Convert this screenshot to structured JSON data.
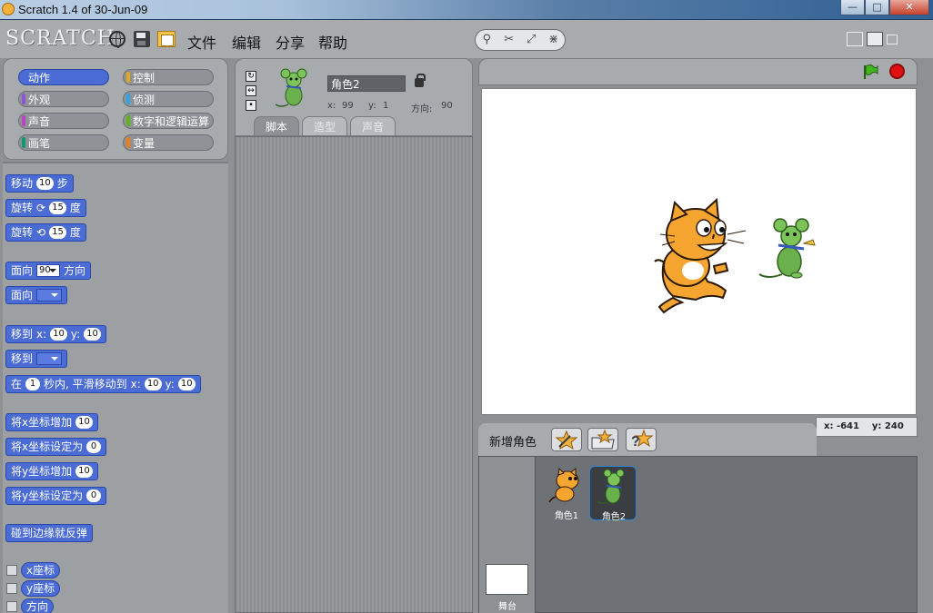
{
  "window": {
    "title": "Scratch 1.4 of 30-Jun-09",
    "controls": [
      "—",
      "□",
      "✕"
    ]
  },
  "menubar": {
    "logo": "SCRATCH",
    "items": [
      "文件",
      "编辑",
      "分享",
      "帮助"
    ],
    "icons": [
      "globe-icon",
      "save-icon",
      "share-icon"
    ]
  },
  "categories": [
    {
      "label": "动作",
      "color": "#4a6cd4",
      "active": true
    },
    {
      "label": "控制",
      "color": "#e1a91a",
      "active": false
    },
    {
      "label": "外观",
      "color": "#8a55d7",
      "active": false
    },
    {
      "label": "侦测",
      "color": "#2ca5e2",
      "active": false
    },
    {
      "label": "声音",
      "color": "#bb42c3",
      "active": false
    },
    {
      "label": "数字和逻辑运算",
      "color": "#5cb712",
      "active": false
    },
    {
      "label": "画笔",
      "color": "#0e9a6c",
      "active": false
    },
    {
      "label": "变量",
      "color": "#ee7d16",
      "active": false
    }
  ],
  "blocks": {
    "move": {
      "pre": "移动",
      "val": "10",
      "post": "步"
    },
    "turn_right": {
      "pre": "旋转",
      "val": "15",
      "post": "度"
    },
    "turn_left": {
      "pre": "旋转",
      "val": "15",
      "post": "度"
    },
    "point_dir": {
      "pre": "面向",
      "val": "90",
      "post": "方向"
    },
    "point_towards": {
      "pre": "面向"
    },
    "goto_xy": {
      "pre": "移到",
      "x_label": "x:",
      "x": "10",
      "y_label": "y:",
      "y": "10"
    },
    "goto": {
      "pre": "移到"
    },
    "glide": {
      "pre": "在",
      "secs": "1",
      "mid": "秒内, 平滑移动到",
      "x_label": "x:",
      "x": "10",
      "y_label": "y:",
      "y": "10"
    },
    "change_x": {
      "pre": "将x坐标增加",
      "val": "10"
    },
    "set_x": {
      "pre": "将x坐标设定为",
      "val": "0"
    },
    "change_y": {
      "pre": "将y坐标增加",
      "val": "10"
    },
    "set_y": {
      "pre": "将y坐标设定为",
      "val": "0"
    },
    "bounce": {
      "pre": "碰到边缘就反弹"
    },
    "reporters": [
      "x座标",
      "y座标",
      "方向"
    ]
  },
  "sprite": {
    "name": "角色2",
    "x_label": "x:",
    "x": "99",
    "y_label": "y:",
    "y": "1",
    "dir_label": "方向:",
    "dir": "90"
  },
  "tabs": [
    {
      "label": "脚本",
      "active": true
    },
    {
      "label": "造型",
      "active": false
    },
    {
      "label": "声音",
      "active": false
    }
  ],
  "stage": {
    "mouse_x_label": "x:",
    "mouse_x": "-641",
    "mouse_y_label": "y:",
    "mouse_y": "240"
  },
  "sprite_list": {
    "new_sprite_label": "新增角色",
    "sprites": [
      {
        "label": "角色1",
        "selected": false
      },
      {
        "label": "角色2",
        "selected": true
      }
    ],
    "stage_label": "舞台"
  }
}
